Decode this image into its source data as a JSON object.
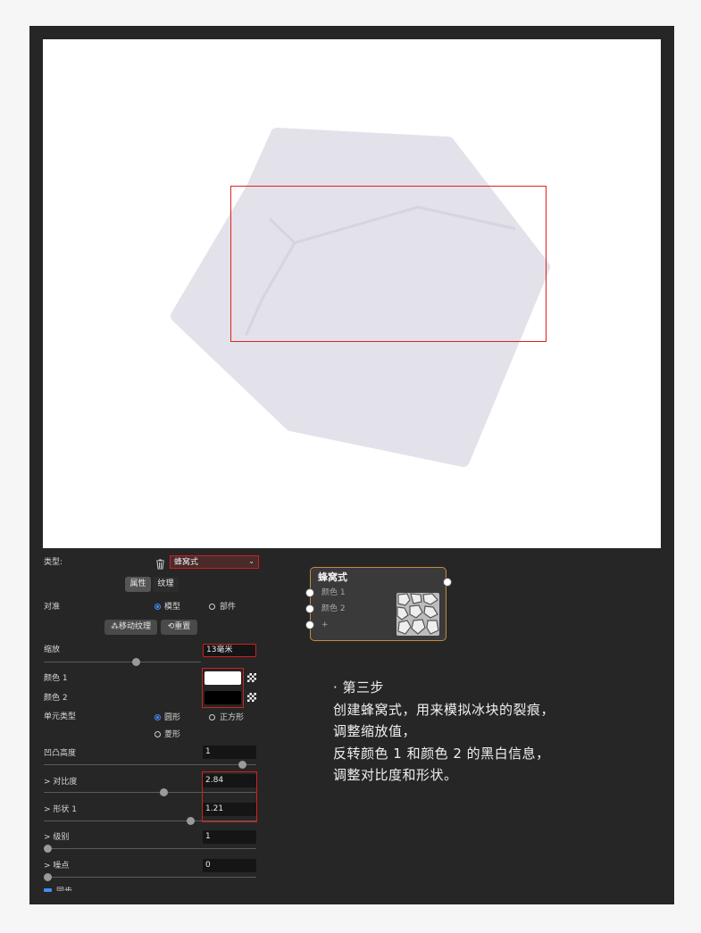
{
  "panel": {
    "type_label": "类型:",
    "type_value": "蜂窝式",
    "tabs": [
      "属性",
      "纹理"
    ],
    "align_label": "对准",
    "align_options": [
      "模型",
      "部件"
    ],
    "move_texture": "移动纹理",
    "reset": "重置",
    "scale_label": "缩放",
    "scale_value": "13毫米",
    "color1_label": "颜色 1",
    "color2_label": "颜色 2",
    "cell_type_label": "单元类型",
    "cell_options": [
      "圆形",
      "正方形",
      "菱形"
    ],
    "bump_label": "凹凸高度",
    "bump_value": "1",
    "contrast_label": "> 对比度",
    "contrast_value": "2.84",
    "shape_label": "> 形状 1",
    "shape_value": "1.21",
    "level_label": "> 级别",
    "level_value": "1",
    "noise_label": "> 噪点",
    "noise_value": "0",
    "truncated_label": "同步"
  },
  "node": {
    "title": "蜂窝式",
    "inputs": [
      "颜色 1",
      "颜色 2",
      "+"
    ]
  },
  "colors": {
    "color1": "#ffffff",
    "color2": "#000000",
    "highlight": "#d21f1f",
    "node_border": "#c58a3e"
  },
  "step": {
    "lines": [
      "· 第三步",
      "创建蜂窝式，用来模拟冰块的裂痕，",
      "调整缩放值，",
      "反转颜色 1 和颜色 2 的黑白信息，",
      "调整对比度和形状。"
    ]
  }
}
